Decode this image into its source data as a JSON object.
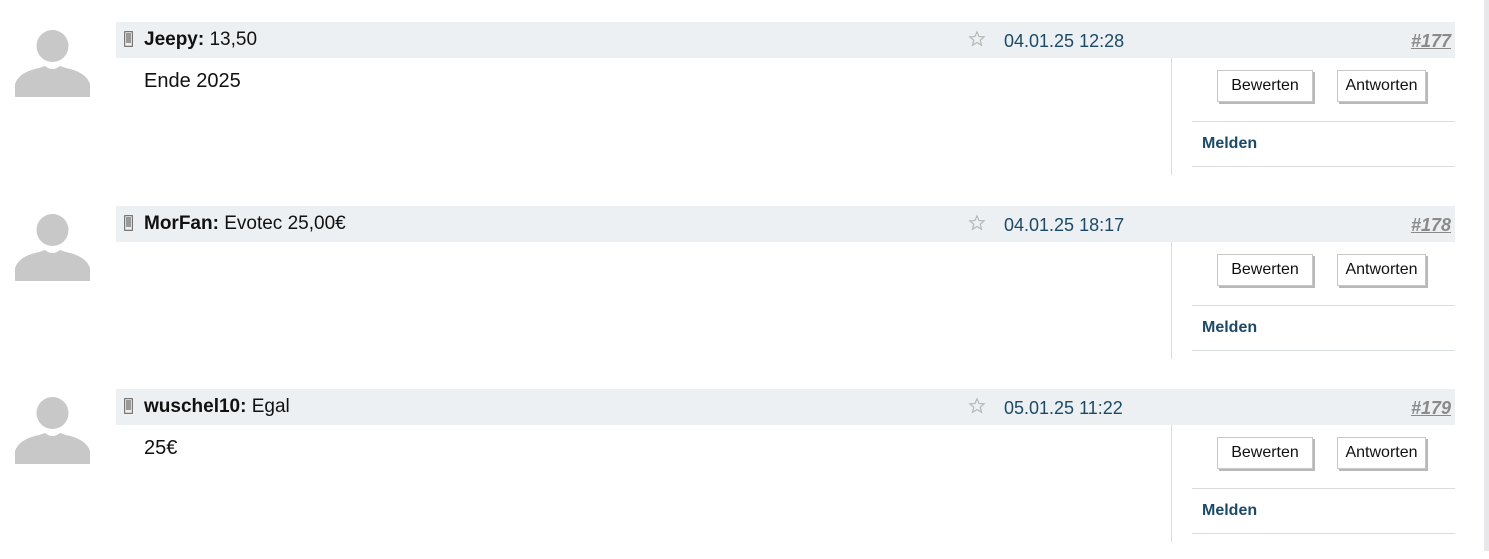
{
  "posts": [
    {
      "author": "Jeepy:",
      "title": "13,50",
      "date": "04.01.25 12:28",
      "number": "#177",
      "body": "Ende 2025",
      "rate_label": "Bewerten",
      "reply_label": "Antworten",
      "report_label": "Melden"
    },
    {
      "author": "MorFan:",
      "title": "Evotec 25,00€",
      "date": "04.01.25 18:17",
      "number": "#178",
      "body": "",
      "rate_label": "Bewerten",
      "reply_label": "Antworten",
      "report_label": "Melden"
    },
    {
      "author": "wuschel10:",
      "title": "Egal",
      "date": "05.01.25 11:22",
      "number": "#179",
      "body": "25€",
      "rate_label": "Bewerten",
      "reply_label": "Antworten",
      "report_label": "Melden"
    }
  ],
  "icons": {
    "avatar": "default-user-avatar-icon",
    "device": "mobile-phone-icon",
    "favorite": "star-outline-icon"
  },
  "colors": {
    "header_bg": "#edf0f2",
    "link": "#1c4a66",
    "post_number": "#8a8a8a",
    "avatar_fill": "#c8c8c8"
  }
}
